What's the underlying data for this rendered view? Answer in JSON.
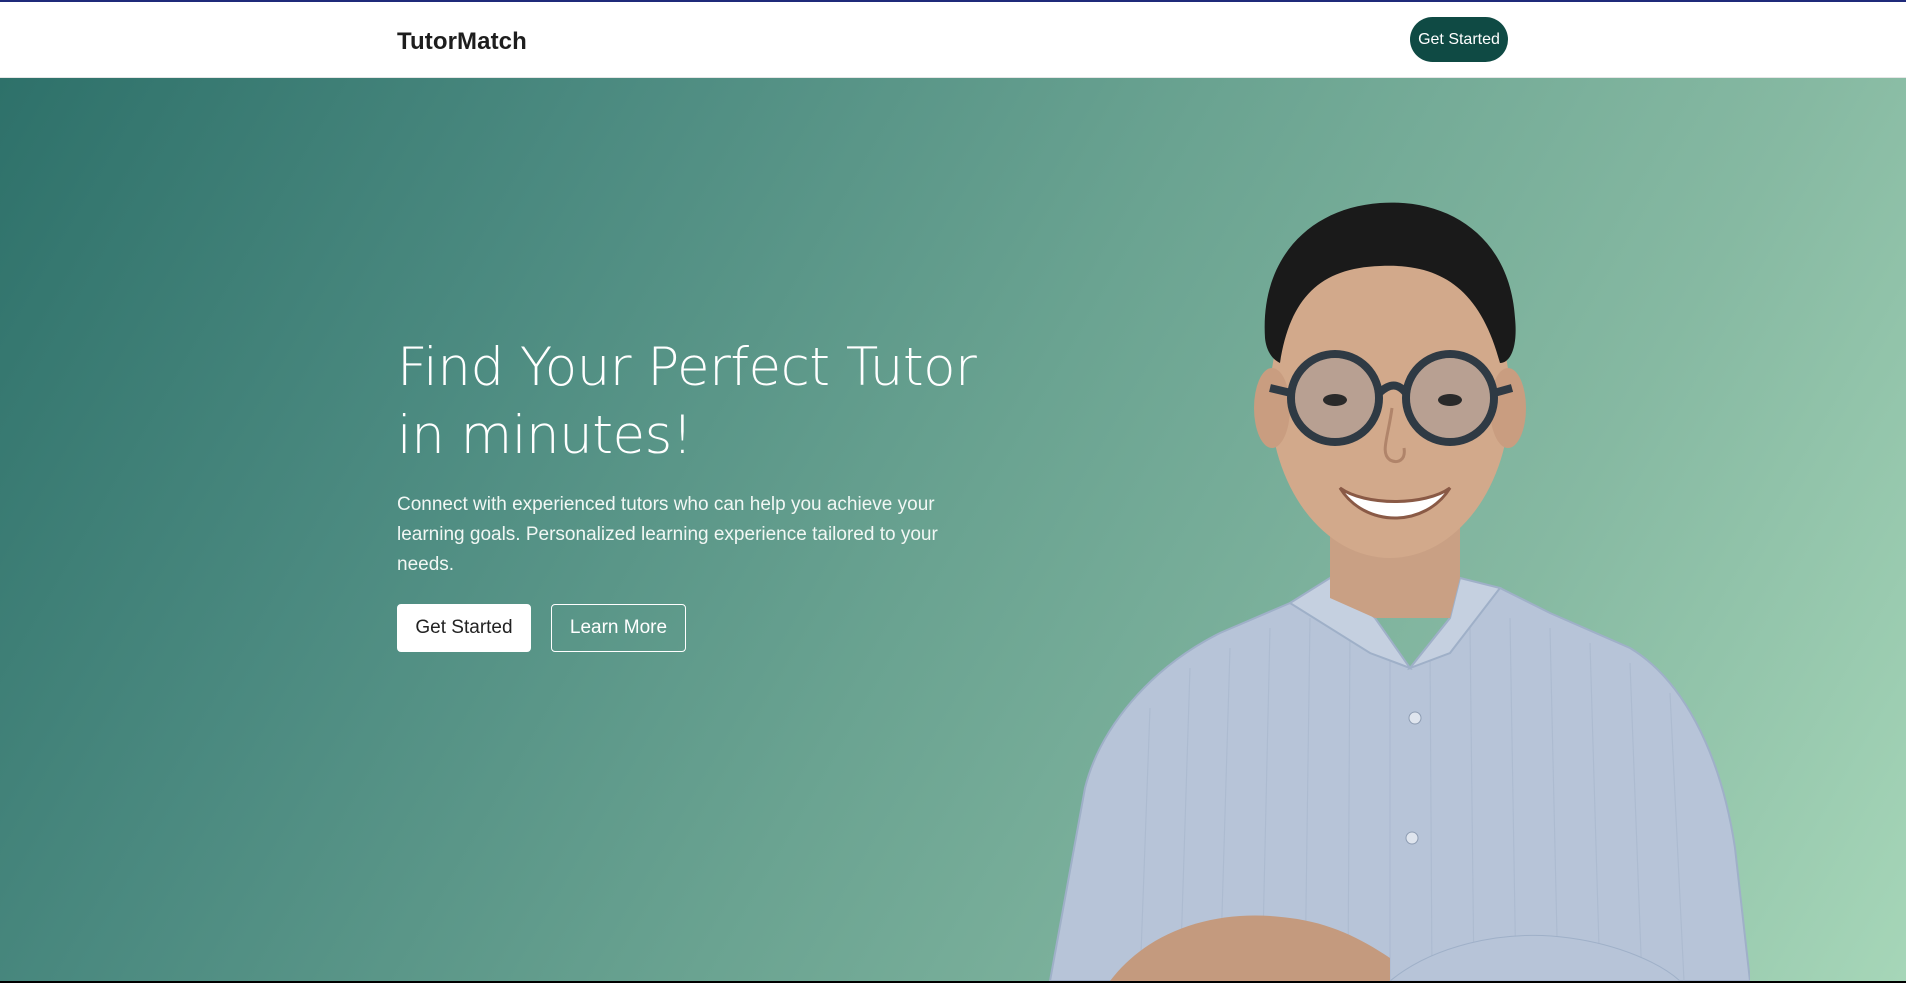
{
  "navbar": {
    "brand": "TutorMatch",
    "cta_label": "Get Started"
  },
  "hero": {
    "title": "Find Your Perfect Tutor in minutes!",
    "subtitle": "Connect with experienced tutors who can help you achieve your learning goals. Personalized learning experience tailored to your needs.",
    "primary_button": "Get Started",
    "secondary_button": "Learn More",
    "image_description": "hero-tutor-portrait"
  },
  "colors": {
    "nav_button_bg": "#0f4a44",
    "hero_gradient_start": "#2e716a",
    "hero_gradient_end": "#a6d6b8",
    "top_accent": "#1f2a7a"
  }
}
